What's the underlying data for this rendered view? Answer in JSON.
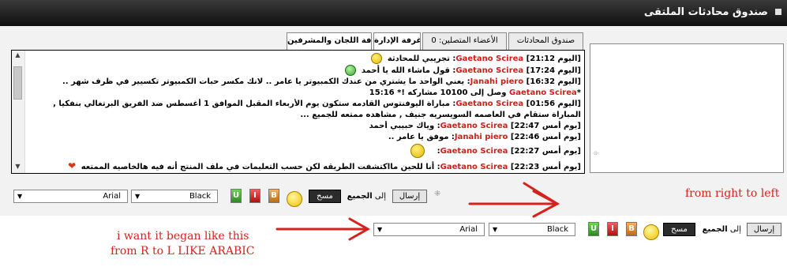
{
  "window": {
    "title": "صندوق محادثات الملتقى"
  },
  "tabs": [
    {
      "label": "صندوق المحادثات",
      "active": false
    },
    {
      "label": "الأعضاء المتصلين: 0",
      "active": false
    },
    {
      "label": "غرفة الإدارة",
      "active": true
    },
    {
      "label": "غرفة اللجان والمشرفين",
      "active": true
    }
  ],
  "messages": [
    {
      "time": "[اليوم 21:12]",
      "nick": "Gaetano Scirea",
      "text": "تجريبي للمحادثة",
      "emoji": "smile-icon"
    },
    {
      "time": "[اليوم 17:24]",
      "nick": "Gaetano Scirea",
      "text": "قول ماشاء الله يا أحمد",
      "emoji": "grin-green-icon"
    },
    {
      "time": "[اليوم 16:32]",
      "nick": "Janahi piero",
      "text": "يعني الواحد ما يشتري من عندك الكمبيوتر يا عامر .. لانك مكسر حبات الكمبيوتر تكسيير في ظرف شهر ..",
      "emoji": ""
    },
    {
      "time": "*",
      "nick": "Gaetano Scirea",
      "text": "وصل إلى 10100 مشاركه !* 15:16",
      "emoji": ""
    },
    {
      "time": "[اليوم 01:56]",
      "nick": "Gaetano Scirea",
      "text": "مباراة اليوفنتوس القادمه ستكون يوم الأربعاء المقبل الموافق 1 أغسطس ضد الفريق البرتغالي بنفكيا , المباراة ستقام في العاصمه السويسريه جنيف , مشاهده ممتعه للجميع ...",
      "emoji": ""
    },
    {
      "time": "[يوم أمس 22:47]",
      "nick": "Gaetano Scirea",
      "text": "وياك حبيبي أحمد",
      "emoji": ""
    },
    {
      "time": "[يوم أمس 22:46]",
      "nick": "Janahi piero",
      "text": "موفق يا عامر ..",
      "emoji": ""
    },
    {
      "time": "[يوم أمس 22:27]",
      "nick": "Gaetano Scirea",
      "text": "",
      "emoji": "smile-icon"
    },
    {
      "time": "[يوم أمس 22:23]",
      "nick": "Gaetano Scirea",
      "text": "أنا للحين مااكتشفت الطريقه لكن حسب التعليمات في ملف المنتج أنه فيه هالخاصيه الممتعه",
      "emoji": "heart-icon"
    }
  ],
  "toolbar": {
    "send_label": "إرسال",
    "to_prefix": "إلى",
    "to_target": "الجميع",
    "clear_label": "مسح",
    "format_u": "U",
    "format_i": "I",
    "format_b": "B",
    "color_select": "Black",
    "font_select": "Arial"
  },
  "annotations": {
    "rtl_note": "from right to left",
    "wish_line1": "i want it began like this",
    "wish_line2": "from R to L LIKE ARABIC"
  },
  "colors": {
    "titlebar": "#1a1a1a",
    "nick": "#d51a1a",
    "annotation": "#d5221d"
  }
}
